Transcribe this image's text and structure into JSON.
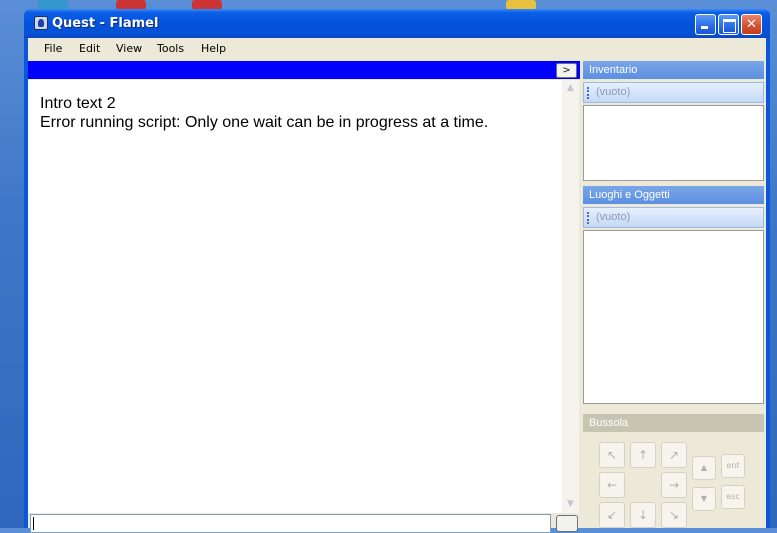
{
  "window": {
    "title": "Quest - Flamel",
    "controls": {
      "minimize": "",
      "maximize": "",
      "close": "✕"
    }
  },
  "menu": [
    "File",
    "Edit",
    "View",
    "Tools",
    "Help"
  ],
  "output": {
    "lines": [
      "Intro text 2",
      "Error running script: Only one wait can be in progress at a time."
    ]
  },
  "toolbar": {
    "expand_label": ">"
  },
  "command_input": {
    "value": ""
  },
  "inventory": {
    "title": "Inventario",
    "empty_label": "(vuoto)"
  },
  "places": {
    "title": "Luoghi e Oggetti",
    "empty_label": "(vuoto)"
  },
  "compass": {
    "title": "Bussola",
    "nw": "↖",
    "n": "↑",
    "ne": "↗",
    "w": "←",
    "e": "→",
    "sw": "↙",
    "s": "↓",
    "se": "↘",
    "up": "▲",
    "down": "▼",
    "enter": "ent",
    "escape": "esc"
  },
  "scroll": {
    "up_arrow": "▲",
    "down_arrow": "▼"
  }
}
